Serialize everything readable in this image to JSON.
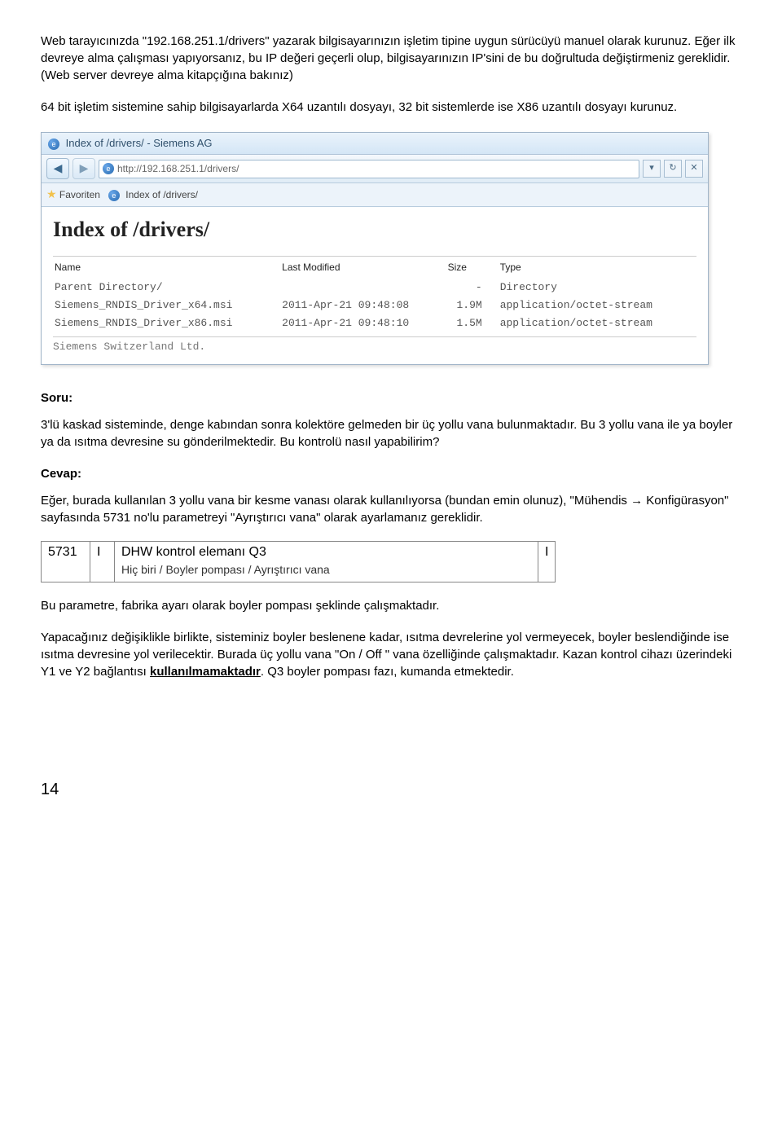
{
  "para1": "Web tarayıcınızda \"192.168.251.1/drivers\" yazarak bilgisayarınızın işletim tipine uygun sürücüyü manuel olarak kurunuz. Eğer ilk devreye alma çalışması yapıyorsanız, bu IP değeri geçerli olup, bilgisayarınızın IP'sini de bu doğrultuda değiştirmeniz gereklidir.(Web server devreye alma kitapçığına bakınız)",
  "para2": "64 bit işletim sistemine sahip bilgisayarlarda X64 uzantılı dosyayı, 32 bit sistemlerde ise X86 uzantılı dosyayı kurunuz.",
  "browser": {
    "title": "Index of /drivers/ - Siemens AG",
    "url": "http://192.168.251.1/drivers/",
    "favLabel": "Favoriten",
    "tabLabel": "Index of /drivers/",
    "heading": "Index of /drivers/",
    "cols": {
      "name": "Name",
      "mod": "Last Modified",
      "size": "Size",
      "type": "Type"
    },
    "rows": [
      {
        "name": "Parent Directory/",
        "mod": "",
        "size": "-",
        "type": "Directory"
      },
      {
        "name": "Siemens_RNDIS_Driver_x64.msi",
        "mod": "2011-Apr-21 09:48:08",
        "size": "1.9M",
        "type": "application/octet-stream"
      },
      {
        "name": "Siemens_RNDIS_Driver_x86.msi",
        "mod": "2011-Apr-21 09:48:10",
        "size": "1.5M",
        "type": "application/octet-stream"
      }
    ],
    "footer": "Siemens Switzerland Ltd."
  },
  "soruLabel": "Soru:",
  "soruBody": "3'lü kaskad sisteminde, denge kabından sonra kolektöre gelmeden bir üç yollu vana bulunmaktadır. Bu 3 yollu vana ile ya boyler ya da ısıtma devresine su gönderilmektedir. Bu kontrolü nasıl yapabilirim?",
  "cevapLabel": "Cevap:",
  "cevapBody": "Eğer, burada kullanılan 3 yollu vana bir kesme vanası olarak kullanılıyorsa (bundan emin olunuz), \"Mühendis → Konfigürasyon\" sayfasında 5731 no'lu parametreyi \"Ayrıştırıcı vana\" olarak ayarlamanız gereklidir.",
  "paramTable": {
    "code": "5731",
    "flag": "I",
    "title": "DHW kontrol elemanı Q3",
    "options": "Hiç biri / Boyler pompası / Ayrıştırıcı vana"
  },
  "after1": "Bu parametre, fabrika ayarı olarak boyler pompası şeklinde çalışmaktadır.",
  "after2a": "Yapacağınız değişiklikle birlikte, sisteminiz boyler beslenene kadar, ısıtma devrelerine yol vermeyecek, boyler beslendiğinde ise ısıtma devresine yol verilecektir. Burada üç yollu vana \"On / Off \" vana özelliğinde çalışmaktadır. Kazan kontrol cihazı üzerindeki Y1 ve Y2 bağlantısı ",
  "after2b": "kullanılmamaktadır",
  "after2c": ". Q3 boyler pompası fazı, kumanda etmektedir.",
  "pageNum": "14"
}
